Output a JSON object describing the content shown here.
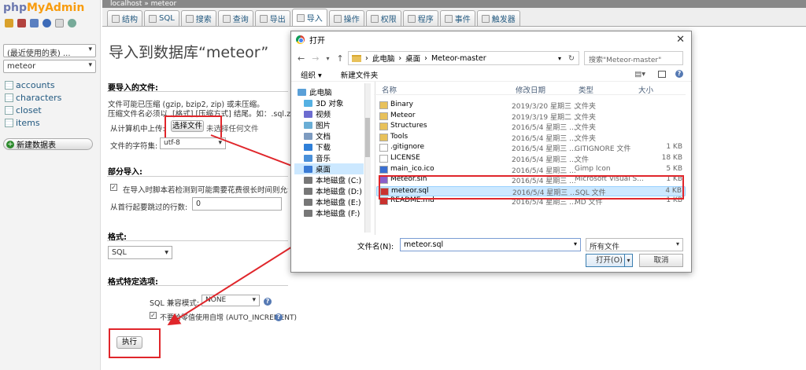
{
  "app": {
    "logo_prefix": "php",
    "logo_main": "MyAdmin"
  },
  "sidebar": {
    "recent_select": "(最近使用的表) ...",
    "db_select": "meteor",
    "tables": [
      "accounts",
      "characters",
      "closet",
      "items"
    ],
    "new_table": "新建数据表"
  },
  "breadcrumb": "localhost » meteor",
  "tabs": [
    {
      "label": "结构"
    },
    {
      "label": "SQL"
    },
    {
      "label": "搜索"
    },
    {
      "label": "查询"
    },
    {
      "label": "导出"
    },
    {
      "label": "导入"
    },
    {
      "label": "操作"
    },
    {
      "label": "权限"
    },
    {
      "label": "程序"
    },
    {
      "label": "事件"
    },
    {
      "label": "触发器"
    }
  ],
  "import": {
    "title": "导入到数据库“meteor”",
    "section_file": "要导入的文件:",
    "hint1": "文件可能已压缩 (gzip, bzip2, zip) 或未压缩。",
    "hint2": "压缩文件名必须以 .[格式].[压缩方式] 结尾。如：.sql.zip",
    "upload_label": "从计算机中上传:",
    "choose_file": "选择文件",
    "no_file": "未选择任何文件",
    "charset_label": "文件的字符集:",
    "charset_value": "utf-8",
    "section_partial": "部分导入:",
    "partial_check": "在导入时脚本若检测到可能需要花费很长时间则允许中断",
    "skip_label": "从首行起要跳过的行数:",
    "skip_value": "0",
    "section_format": "格式:",
    "format_value": "SQL",
    "section_format_specific": "格式特定选项:",
    "compat_label": "SQL 兼容模式:",
    "compat_value": "NONE",
    "auto_inc": "不要给零值使用自增 (AUTO_INCREMENT)",
    "execute": "执行"
  },
  "dialog": {
    "title": "打开",
    "path": [
      "此电脑",
      "桌面",
      "Meteor-master"
    ],
    "search_placeholder": "搜索\"Meteor-master\"",
    "organize": "组织 ▾",
    "new_folder": "新建文件夹",
    "tree": [
      "此电脑",
      "3D 对象",
      "视频",
      "图片",
      "文档",
      "下载",
      "音乐",
      "桌面",
      "本地磁盘 (C:)",
      "本地磁盘 (D:)",
      "本地磁盘 (E:)",
      "本地磁盘 (F:)"
    ],
    "columns": {
      "name": "名称",
      "date": "修改日期",
      "type": "类型",
      "size": "大小"
    },
    "files": [
      {
        "name": "Binary",
        "date": "2019/3/20 星期三 ...",
        "type": "文件夹",
        "size": "",
        "kind": "folder"
      },
      {
        "name": "Meteor",
        "date": "2019/3/19 星期二 ...",
        "type": "文件夹",
        "size": "",
        "kind": "folder"
      },
      {
        "name": "Structures",
        "date": "2016/5/4 星期三 ...",
        "type": "文件夹",
        "size": "",
        "kind": "folder"
      },
      {
        "name": "Tools",
        "date": "2016/5/4 星期三 ...",
        "type": "文件夹",
        "size": "",
        "kind": "folder"
      },
      {
        "name": ".gitignore",
        "date": "2016/5/4 星期三 ...",
        "type": "GITIGNORE 文件",
        "size": "1 KB",
        "kind": "file"
      },
      {
        "name": "LICENSE",
        "date": "2016/5/4 星期三 ...",
        "type": "文件",
        "size": "18 KB",
        "kind": "file"
      },
      {
        "name": "main_ico.ico",
        "date": "2016/5/4 星期三 ...",
        "type": "Gimp Icon",
        "size": "5 KB",
        "kind": "ico"
      },
      {
        "name": "Meteor.sln",
        "date": "2016/5/4 星期三 ...",
        "type": "Microsoft Visual S...",
        "size": "1 KB",
        "kind": "sln"
      },
      {
        "name": "meteor.sql",
        "date": "2016/5/4 星期三 ...",
        "type": "SQL 文件",
        "size": "4 KB",
        "kind": "sql",
        "selected": true
      },
      {
        "name": "README.md",
        "date": "2016/5/4 星期三 ...",
        "type": "MD 文件",
        "size": "1 KB",
        "kind": "md"
      }
    ],
    "filename_label": "文件名(N):",
    "filename_value": "meteor.sql",
    "filetype_value": "所有文件",
    "open_label": "打开(O)",
    "cancel_label": "取消"
  },
  "colors": {
    "accent": "#235a81",
    "highlight": "#e0262b",
    "selected_row": "#cce8ff"
  }
}
